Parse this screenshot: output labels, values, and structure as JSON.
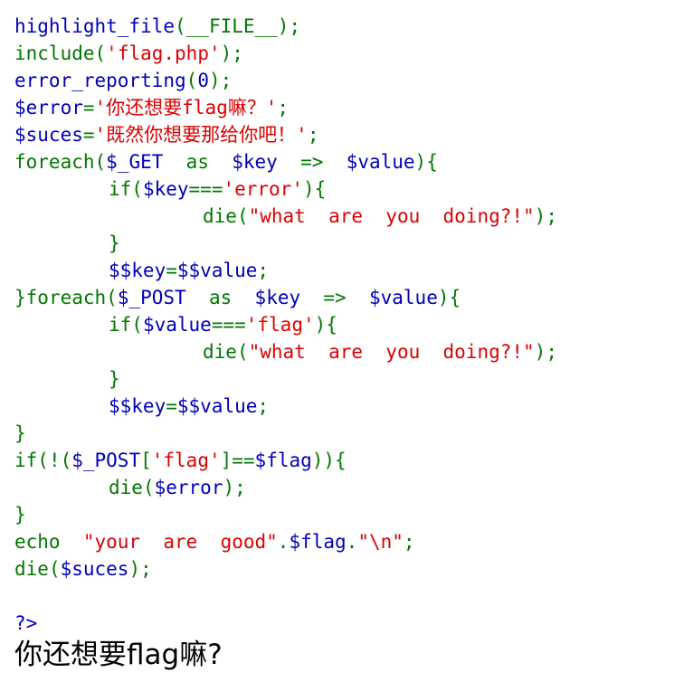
{
  "code_lines": [
    {
      "parts": [
        {
          "t": "highlight_file",
          "c": "fn"
        },
        {
          "t": "(__FILE__);",
          "c": "op"
        }
      ]
    },
    {
      "parts": [
        {
          "t": "include",
          "c": "kw"
        },
        {
          "t": "(",
          "c": "op"
        },
        {
          "t": "'flag.php'",
          "c": "str"
        },
        {
          "t": ");",
          "c": "op"
        }
      ]
    },
    {
      "parts": [
        {
          "t": "error_reporting",
          "c": "fn"
        },
        {
          "t": "(",
          "c": "op"
        },
        {
          "t": "0",
          "c": "fn"
        },
        {
          "t": ");",
          "c": "op"
        }
      ]
    },
    {
      "parts": [
        {
          "t": "$error",
          "c": "var"
        },
        {
          "t": "=",
          "c": "op"
        },
        {
          "t": "'你还想要flag嘛？'",
          "c": "str"
        },
        {
          "t": ";",
          "c": "op"
        }
      ]
    },
    {
      "parts": [
        {
          "t": "$suces",
          "c": "var"
        },
        {
          "t": "=",
          "c": "op"
        },
        {
          "t": "'既然你想要那给你吧！'",
          "c": "str"
        },
        {
          "t": ";",
          "c": "op"
        }
      ]
    },
    {
      "parts": [
        {
          "t": "foreach",
          "c": "kw"
        },
        {
          "t": "(",
          "c": "op"
        },
        {
          "t": "$_GET",
          "c": "var"
        },
        {
          "t": "  as  ",
          "c": "kw"
        },
        {
          "t": "$key",
          "c": "var"
        },
        {
          "t": "  =>  ",
          "c": "op"
        },
        {
          "t": "$value",
          "c": "var"
        },
        {
          "t": "){",
          "c": "op"
        }
      ]
    },
    {
      "indent": 1,
      "parts": [
        {
          "t": "if",
          "c": "kw"
        },
        {
          "t": "(",
          "c": "op"
        },
        {
          "t": "$key",
          "c": "var"
        },
        {
          "t": "===",
          "c": "op"
        },
        {
          "t": "'error'",
          "c": "str"
        },
        {
          "t": "){",
          "c": "op"
        }
      ]
    },
    {
      "indent": 2,
      "parts": [
        {
          "t": "die",
          "c": "kw"
        },
        {
          "t": "(",
          "c": "op"
        },
        {
          "t": "\"what  are  you  doing?!\"",
          "c": "str"
        },
        {
          "t": ");",
          "c": "op"
        }
      ]
    },
    {
      "indent": 1,
      "parts": [
        {
          "t": "}",
          "c": "op"
        }
      ]
    },
    {
      "indent": 1,
      "parts": [
        {
          "t": "$$key",
          "c": "var"
        },
        {
          "t": "=",
          "c": "op"
        },
        {
          "t": "$$value",
          "c": "var"
        },
        {
          "t": ";",
          "c": "op"
        }
      ]
    },
    {
      "parts": [
        {
          "t": "}",
          "c": "op"
        },
        {
          "t": "foreach",
          "c": "kw"
        },
        {
          "t": "(",
          "c": "op"
        },
        {
          "t": "$_POST",
          "c": "var"
        },
        {
          "t": "  as  ",
          "c": "kw"
        },
        {
          "t": "$key",
          "c": "var"
        },
        {
          "t": "  =>  ",
          "c": "op"
        },
        {
          "t": "$value",
          "c": "var"
        },
        {
          "t": "){",
          "c": "op"
        }
      ]
    },
    {
      "indent": 1,
      "parts": [
        {
          "t": "if",
          "c": "kw"
        },
        {
          "t": "(",
          "c": "op"
        },
        {
          "t": "$value",
          "c": "var"
        },
        {
          "t": "===",
          "c": "op"
        },
        {
          "t": "'flag'",
          "c": "str"
        },
        {
          "t": "){",
          "c": "op"
        }
      ]
    },
    {
      "indent": 2,
      "parts": [
        {
          "t": "die",
          "c": "kw"
        },
        {
          "t": "(",
          "c": "op"
        },
        {
          "t": "\"what  are  you  doing?!\"",
          "c": "str"
        },
        {
          "t": ");",
          "c": "op"
        }
      ]
    },
    {
      "indent": 1,
      "parts": [
        {
          "t": "}",
          "c": "op"
        }
      ]
    },
    {
      "indent": 1,
      "parts": [
        {
          "t": "$$key",
          "c": "var"
        },
        {
          "t": "=",
          "c": "op"
        },
        {
          "t": "$$value",
          "c": "var"
        },
        {
          "t": ";",
          "c": "op"
        }
      ]
    },
    {
      "parts": [
        {
          "t": "}",
          "c": "op"
        }
      ]
    },
    {
      "parts": [
        {
          "t": "if",
          "c": "kw"
        },
        {
          "t": "(!(",
          "c": "op"
        },
        {
          "t": "$_POST",
          "c": "var"
        },
        {
          "t": "[",
          "c": "op"
        },
        {
          "t": "'flag'",
          "c": "str"
        },
        {
          "t": "]==",
          "c": "op"
        },
        {
          "t": "$flag",
          "c": "var"
        },
        {
          "t": ")){",
          "c": "op"
        }
      ]
    },
    {
      "indent": 1,
      "parts": [
        {
          "t": "die",
          "c": "kw"
        },
        {
          "t": "(",
          "c": "op"
        },
        {
          "t": "$error",
          "c": "var"
        },
        {
          "t": ");",
          "c": "op"
        }
      ]
    },
    {
      "parts": [
        {
          "t": "}",
          "c": "op"
        }
      ]
    },
    {
      "parts": [
        {
          "t": "echo  ",
          "c": "kw"
        },
        {
          "t": "\"your  are  good\"",
          "c": "str"
        },
        {
          "t": ".",
          "c": "op"
        },
        {
          "t": "$flag",
          "c": "var"
        },
        {
          "t": ".",
          "c": "op"
        },
        {
          "t": "\"\\n\"",
          "c": "str"
        },
        {
          "t": ";",
          "c": "op"
        }
      ]
    },
    {
      "parts": [
        {
          "t": "die",
          "c": "kw"
        },
        {
          "t": "(",
          "c": "op"
        },
        {
          "t": "$suces",
          "c": "var"
        },
        {
          "t": ");",
          "c": "op"
        }
      ]
    },
    {
      "parts": []
    },
    {
      "parts": [
        {
          "t": "?>",
          "c": "tag"
        }
      ]
    }
  ],
  "output_text": "你还想要flag嘛?",
  "colors": {
    "function": "#0000bb",
    "keyword": "#007700",
    "string": "#dd0000",
    "background": "#ffffff"
  }
}
